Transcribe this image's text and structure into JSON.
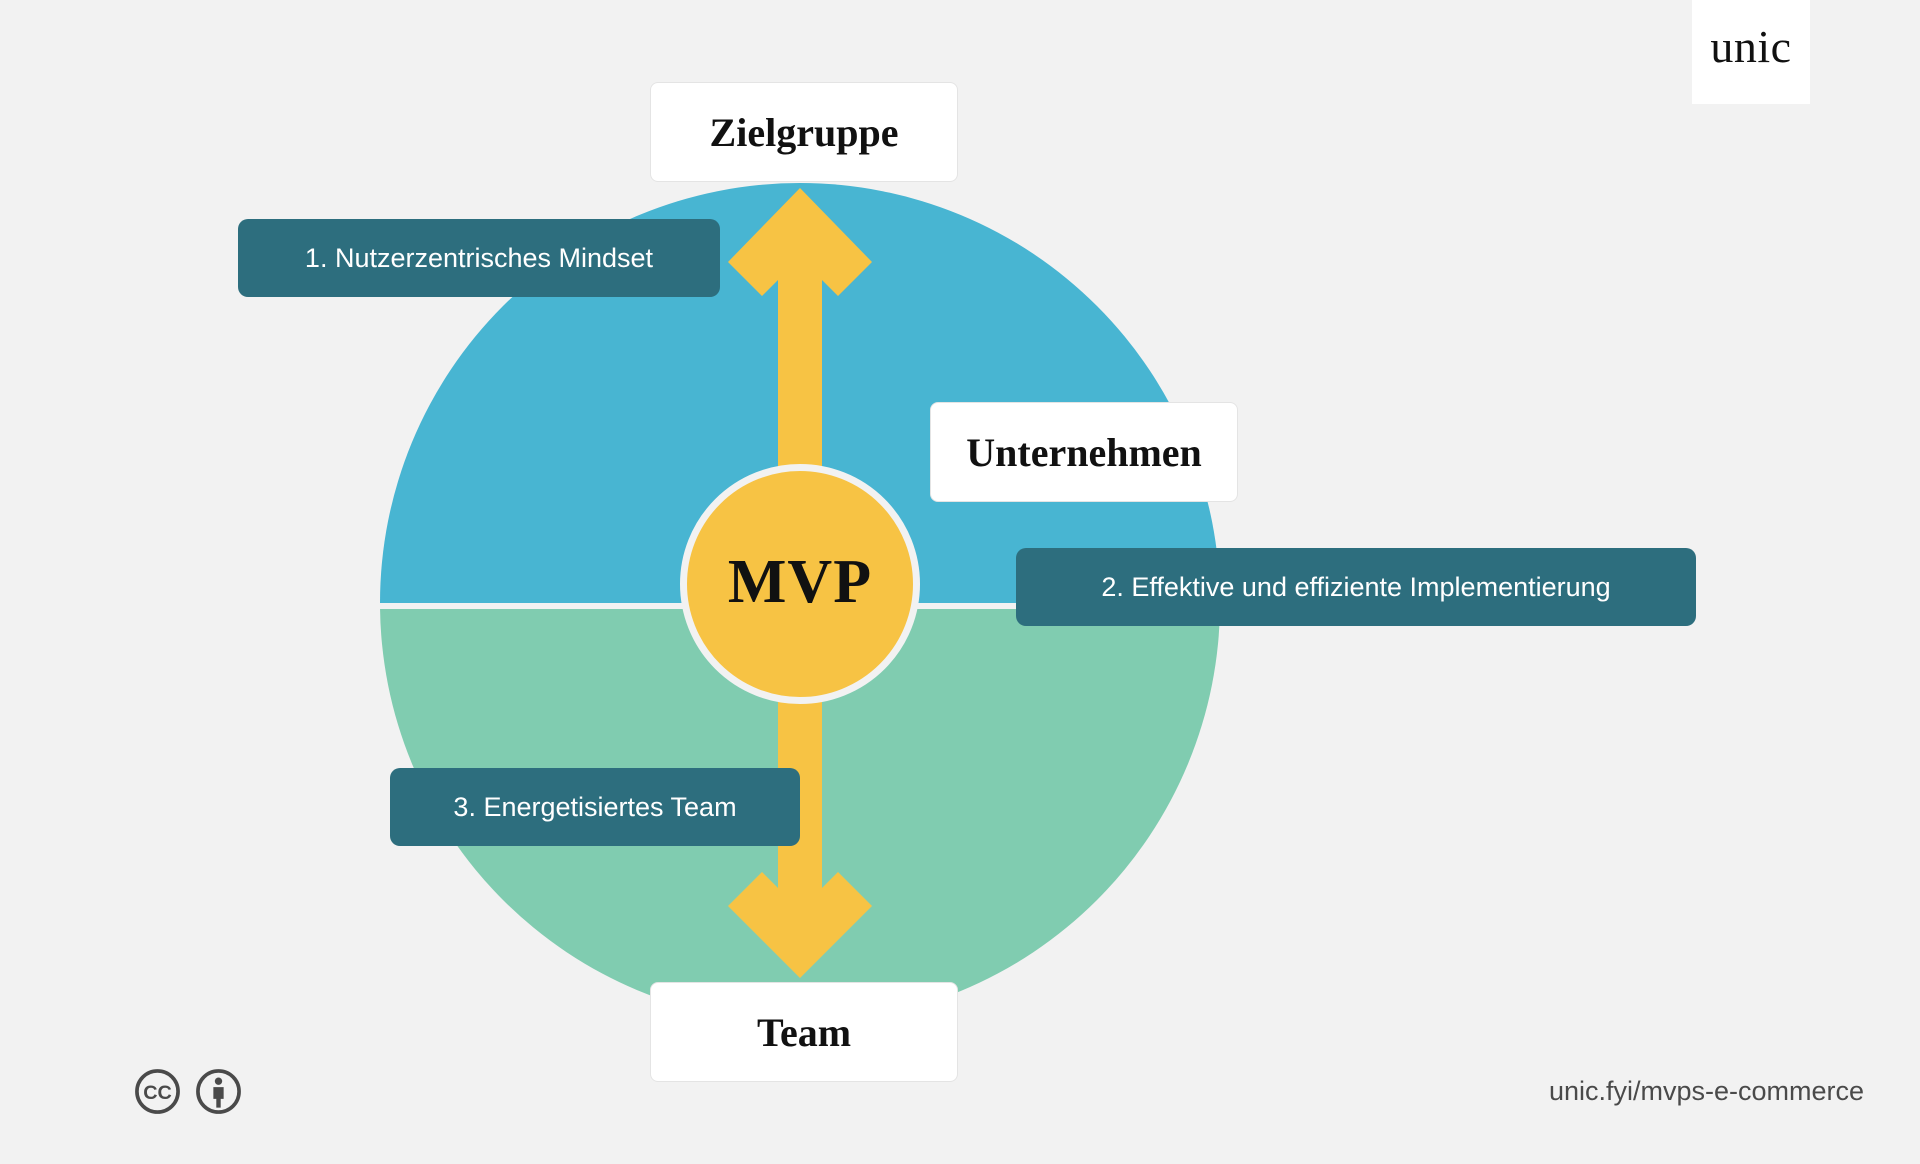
{
  "brand": {
    "logo_text": "unic",
    "accent_blue": "#48b5d2",
    "accent_green": "#80ccb0",
    "accent_yellow": "#f7c344",
    "accent_teal": "#2d6e7e",
    "background": "#f2f2f2"
  },
  "diagram": {
    "center": {
      "label": "MVP"
    },
    "poles": {
      "top": "Zielgruppe",
      "right": "Unternehmen",
      "bottom": "Team"
    },
    "badges": [
      {
        "text": "1. Nutzerzentrisches Mindset"
      },
      {
        "text": "2. Effektive und effiziente Implementierung"
      },
      {
        "text": "3. Energetisiertes Team"
      }
    ]
  },
  "footer": {
    "license_icons": [
      "creative-commons-icon",
      "attribution-icon"
    ],
    "url": "unic.fyi/mvps-e-commerce"
  }
}
